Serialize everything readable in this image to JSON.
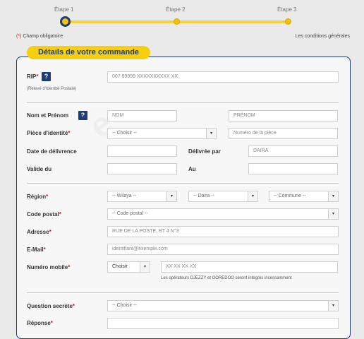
{
  "stepper": {
    "steps": [
      {
        "label": "Étape 1",
        "active": true
      },
      {
        "label": "Étape 2",
        "active": false
      },
      {
        "label": "Étape 3",
        "active": false
      }
    ],
    "accent": "#f2c30f",
    "brand": "#1d3c78"
  },
  "required_note": {
    "star": "(*)",
    "text": " Champ obligatoire"
  },
  "terms_link": "Les conditions générales",
  "panel_title": "Détails de votre commande",
  "help_icon": "?",
  "required_star": "*",
  "fields": {
    "rip": {
      "label": "RIP",
      "sublabel": "(Relevé d'Identité Postale)",
      "value": "007 99999 XXXXXXXXXX XX"
    },
    "nom_prenom": {
      "label": "Nom et Prénom",
      "nom_placeholder": "NOM",
      "prenom_placeholder": "PRÉNOM"
    },
    "piece": {
      "label": "Pièce d'identité",
      "select": "-- Choisir --",
      "numero_placeholder": "Numéro de la pièce"
    },
    "date_delivrance": {
      "label": "Date de délivrence"
    },
    "delivree_par": {
      "label": "Délivrée par",
      "placeholder": "DAIRA"
    },
    "valide_du": {
      "label": "Valide du"
    },
    "au": {
      "label": "Au"
    },
    "region": {
      "label": "Région",
      "wilaya": "-- Wilaya --",
      "daira": "-- Daira --",
      "commune": "-- Commune --"
    },
    "code_postal": {
      "label": "Code postal",
      "select": "-- Code postal --"
    },
    "adresse": {
      "label": "Adresse",
      "value": "RUE DE LA POSTE, BT 4 N°3"
    },
    "email": {
      "label": "E-Mail",
      "placeholder": "identifiant@exemple.com"
    },
    "mobile": {
      "label": "Numéro mobile",
      "prefix": "Choisir",
      "placeholder": "XX XX XX XX",
      "note": "Les opérateurs DJEZZY et OOREDOO seront integrés incessamment"
    },
    "question": {
      "label": "Question secrète",
      "select": "-- Choisir --"
    },
    "reponse": {
      "label": "Réponse"
    }
  },
  "dropdown_icon": "▾"
}
